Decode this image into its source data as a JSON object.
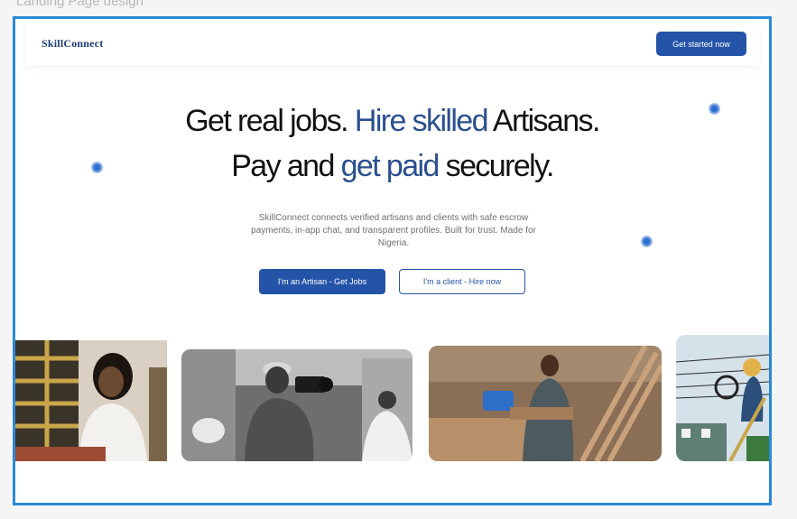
{
  "canvas": {
    "label": "Landing Page design"
  },
  "navbar": {
    "logo": "SkillConnect",
    "cta_label": "Get started now"
  },
  "hero": {
    "line1_part1": "Get real jobs.",
    "line1_part2": "Hire skilled",
    "line1_part3": "Artisans.",
    "line2_part1": "Pay and",
    "line2_part2": "get paid",
    "line2_part3": "securely.",
    "subtitle": "SkillConnect connects verified artisans and clients with safe escrow payments, in-app chat, and transparent profiles. Built for trust. Made for Nigeria.",
    "primary_button": "I'm an Artisan - Get Jobs",
    "secondary_button": "I'm a client - Hire now"
  },
  "colors": {
    "brand": "#2454a8",
    "accent_text": "#2a4f8f",
    "frame_selection": "#2a8ad6"
  },
  "gallery": {
    "photos": [
      {
        "icon": "woman-on-phone-photo"
      },
      {
        "icon": "photographer-photo"
      },
      {
        "icon": "carpenter-photo"
      },
      {
        "icon": "electrician-photo"
      }
    ]
  }
}
